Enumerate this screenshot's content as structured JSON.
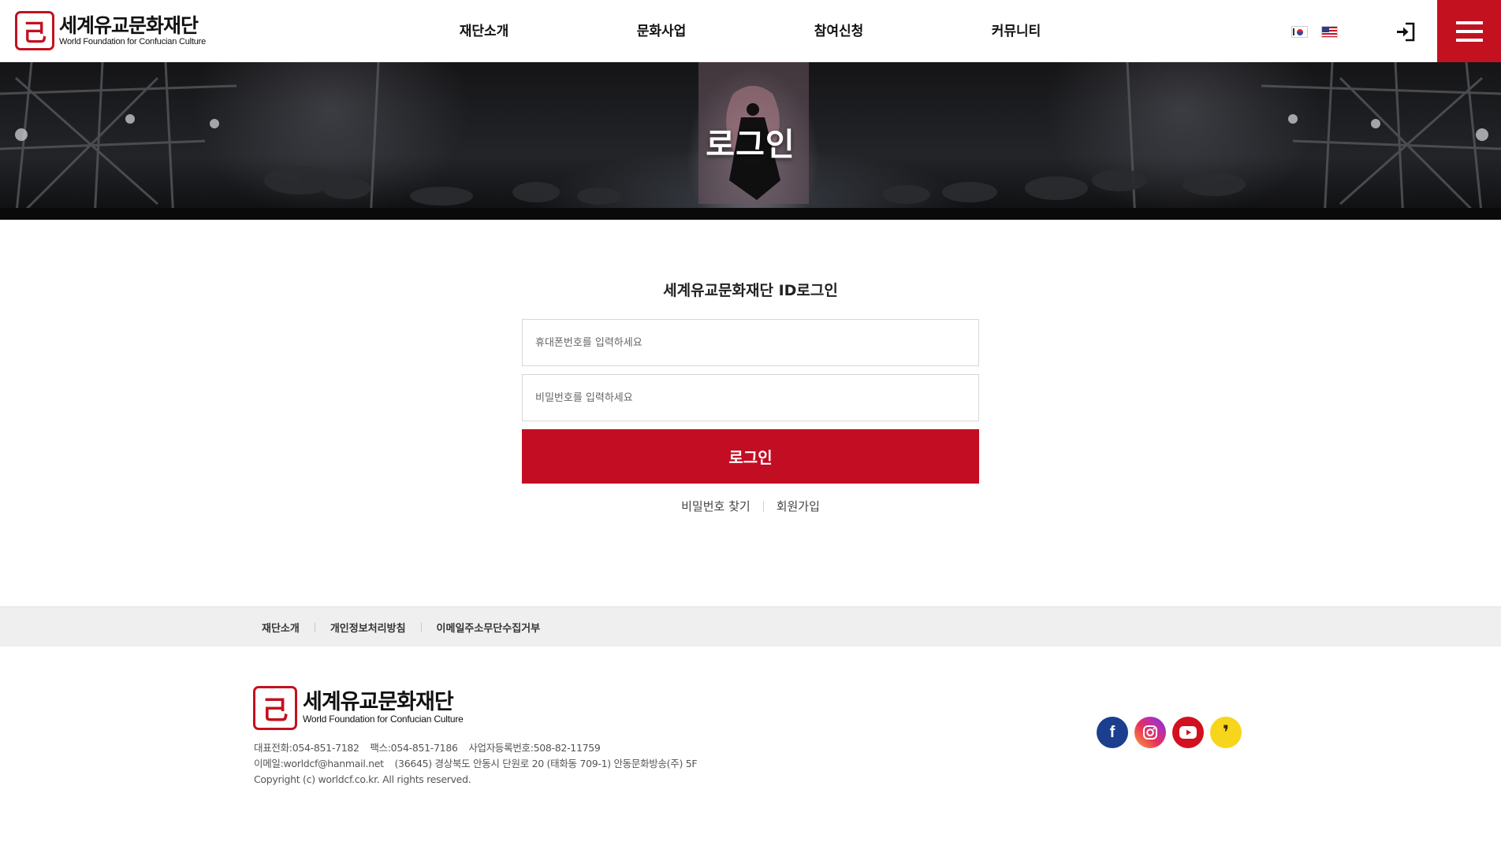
{
  "header": {
    "logo": {
      "seal_glyph": "己",
      "name_ko": "세계유교문화재단",
      "name_en": "World Foundation for Confucian Culture"
    },
    "nav": [
      "재단소개",
      "문화사업",
      "참여신청",
      "커뮤니티"
    ],
    "languages": [
      "kr-flag-icon",
      "us-flag-icon"
    ],
    "login_icon": "sign-in-icon",
    "menu_icon": "hamburger-menu-icon",
    "accent_color": "#c3111f"
  },
  "hero": {
    "title": "로그인"
  },
  "login": {
    "title": "세계유교문화재단 ID로그인",
    "phone_placeholder": "휴대폰번호를 입력하세요",
    "password_placeholder": "비밀번호를 입력하세요",
    "submit_label": "로그인",
    "find_password": "비밀번호 찾기",
    "signup": "회원가입",
    "button_color": "#c30d23"
  },
  "footer": {
    "nav": [
      "재단소개",
      "개인정보처리방침",
      "이메일주소무단수집거부"
    ],
    "logo": {
      "seal_glyph": "己",
      "name_ko": "세계유교문화재단",
      "name_en": "World Foundation for Confucian Culture"
    },
    "info": {
      "tel": "대표전화:054-851-7182",
      "fax": "팩스:054-851-7186",
      "biz_no": "사업자등록번호:508-82-11759",
      "email": "이메일:worldcf@hanmail.net",
      "address": "(36645) 경상북도 안동시 단원로 20 (태화동 709-1) 안동문화방송(주) 5F",
      "copyright": "Copyright (c) worldcf.co.kr. All rights reserved."
    },
    "sns": [
      {
        "name": "facebook-icon",
        "glyph": "f",
        "color": "#1b3f8e"
      },
      {
        "name": "instagram-icon",
        "glyph": "",
        "color": "#e8315a"
      },
      {
        "name": "youtube-icon",
        "glyph": "",
        "color": "#d21020"
      },
      {
        "name": "kakaostory-icon",
        "glyph": "❜",
        "color": "#f7d51a"
      }
    ]
  }
}
